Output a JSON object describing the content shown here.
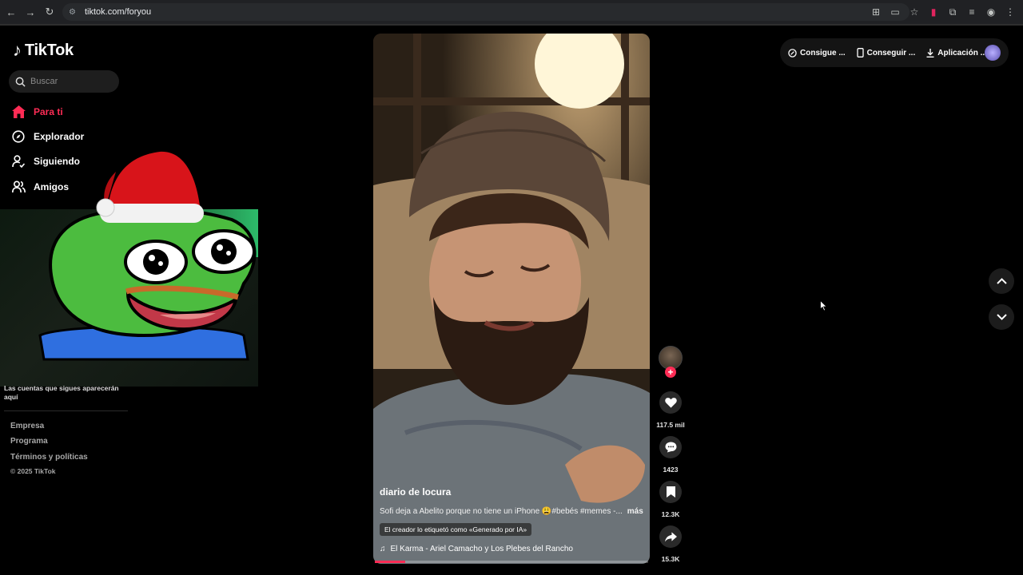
{
  "browser": {
    "url": "tiktok.com/foryou"
  },
  "app": {
    "logo_text": "TikTok"
  },
  "search": {
    "placeholder": "Buscar"
  },
  "sidebar": {
    "items": [
      {
        "label": "Para ti",
        "icon": "home-icon",
        "active": true
      },
      {
        "label": "Explorador",
        "icon": "compass-icon",
        "active": false
      },
      {
        "label": "Siguiendo",
        "icon": "user-follow-icon",
        "active": false
      },
      {
        "label": "Amigos",
        "icon": "friends-icon",
        "active": false
      }
    ],
    "followers_note": "Las cuentas que sigues aparecerán aquí",
    "footer_links": [
      "Empresa",
      "Programa",
      "Términos y políticas"
    ],
    "copyright": "© 2025 TikTok"
  },
  "header": {
    "pill_items": [
      {
        "label": "Consigue ...",
        "icon": "coin-icon"
      },
      {
        "label": "Conseguir ...",
        "icon": "phone-icon"
      },
      {
        "label": "Aplicación ...",
        "icon": "download-icon"
      }
    ]
  },
  "video": {
    "author": "diario de locura",
    "description": "Sofi deja a Abelito porque no tiene un iPhone 😩#bebés #memes -...",
    "more_label": "más",
    "ai_label": "El creador lo etiquetó como «Generado por IA»",
    "music": "El Karma - Ariel Camacho y Los Plebes del Rancho",
    "progress": 0.11
  },
  "actions": {
    "likes": "117.5 mil",
    "comments": "1423",
    "saves": "12.3K",
    "shares": "15.3K"
  },
  "colors": {
    "accent": "#fe2c55",
    "background": "#000000"
  }
}
